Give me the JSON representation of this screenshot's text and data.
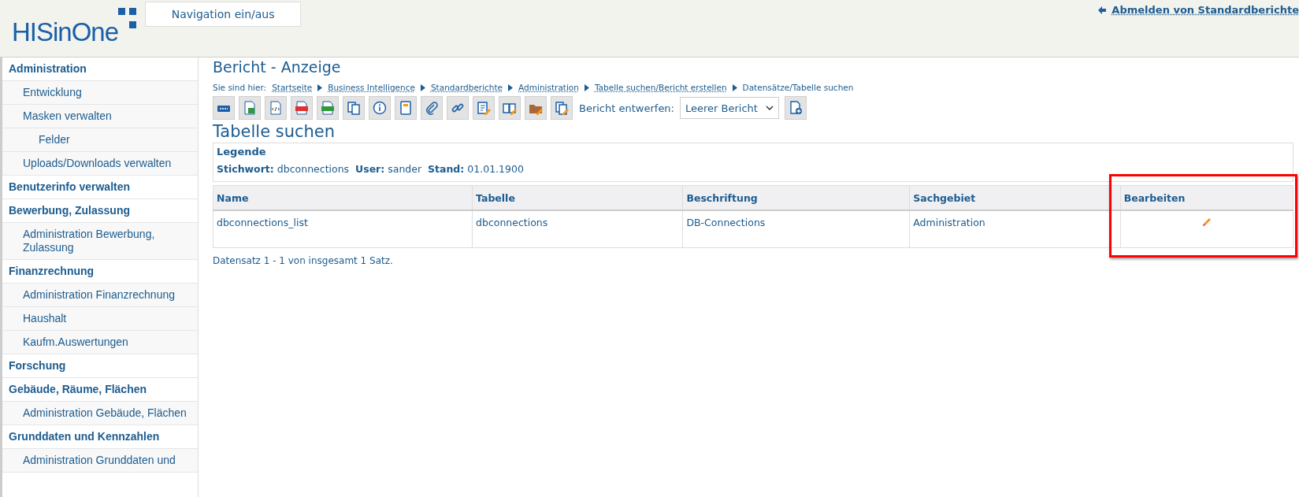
{
  "header": {
    "logo": "HISinOne",
    "nav_toggle": "Navigation ein/aus",
    "logout": "Abmelden von Standardberichte"
  },
  "sidebar": {
    "items": [
      {
        "label": "Administration",
        "children": [
          {
            "label": "Entwicklung"
          },
          {
            "label": "Masken verwalten",
            "children": [
              {
                "label": "Felder"
              }
            ]
          },
          {
            "label": "Uploads/Downloads verwalten"
          }
        ]
      },
      {
        "label": "Benutzerinfo verwalten"
      },
      {
        "label": "Bewerbung, Zulassung",
        "children": [
          {
            "label": "Administration Bewerbung, Zulassung"
          }
        ]
      },
      {
        "label": "Finanzrechnung",
        "children": [
          {
            "label": "Administration Finanzrechnung"
          },
          {
            "label": "Haushalt"
          },
          {
            "label": "Kaufm.Auswertungen"
          }
        ]
      },
      {
        "label": "Forschung"
      },
      {
        "label": "Gebäude, Räume, Flächen",
        "children": [
          {
            "label": "Administration Gebäude, Flächen"
          }
        ]
      },
      {
        "label": "Grunddaten und Kennzahlen",
        "children": [
          {
            "label": "Administration Grunddaten und"
          }
        ]
      }
    ]
  },
  "page_title": "Bericht - Anzeige",
  "breadcrumb": {
    "prefix": "Sie sind hier:",
    "links": [
      "Startseite",
      "Business Intelligence",
      "Standardberichte",
      "Administration",
      "Tabelle suchen/Bericht erstellen"
    ],
    "current": "Datensätze/Tabelle suchen"
  },
  "toolbar": {
    "buttons": [
      {
        "kind": "html"
      },
      {
        "kind": "excel"
      },
      {
        "kind": "xml"
      },
      {
        "kind": "pdf"
      },
      {
        "kind": "csv"
      },
      {
        "kind": "copy"
      },
      {
        "kind": "info"
      },
      {
        "kind": "notebook"
      },
      {
        "kind": "paperclip"
      },
      {
        "kind": "link"
      },
      {
        "kind": "edit-document"
      },
      {
        "kind": "edit-book"
      },
      {
        "kind": "edit-folder"
      },
      {
        "kind": "edit-copy"
      }
    ],
    "design_label": "Bericht entwerfen:",
    "design_select": "Leerer Bericht"
  },
  "section_title": "Tabelle suchen",
  "legend": {
    "title": "Legende",
    "entries": [
      {
        "key": "Stichwort:",
        "value": "dbconnections"
      },
      {
        "key": "User:",
        "value": "sander"
      },
      {
        "key": "Stand:",
        "value": "01.01.1900"
      }
    ]
  },
  "table": {
    "columns": [
      {
        "label": "Name",
        "highlighted": false
      },
      {
        "label": "Tabelle",
        "highlighted": false
      },
      {
        "label": "Beschriftung",
        "highlighted": false
      },
      {
        "label": "Sachgebiet",
        "highlighted": false
      },
      {
        "label": "Bearbeiten",
        "highlighted": true
      }
    ],
    "rows": [
      {
        "cells": [
          "dbconnections_list",
          "dbconnections",
          "DB-Connections",
          "Administration"
        ],
        "edit": true
      }
    ]
  },
  "status": "Datensatz 1 - 1 von insgesamt 1 Satz."
}
